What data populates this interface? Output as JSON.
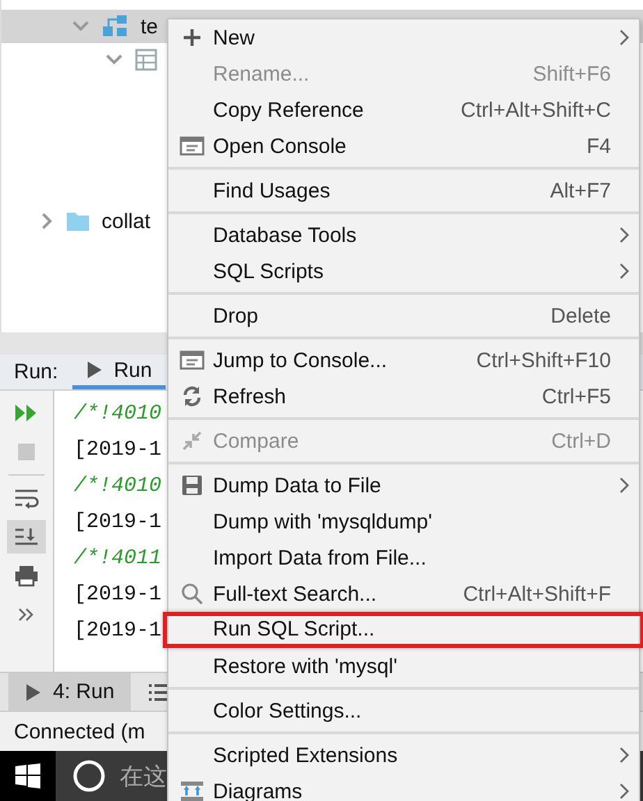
{
  "tree": {
    "items": [
      {
        "label": "te",
        "kind": "schema",
        "expanded": true,
        "selected": true
      },
      {
        "kind": "table",
        "expanded": true,
        "selected": false
      },
      {
        "label": "collat",
        "kind": "folder",
        "expanded": false,
        "selected": false
      }
    ]
  },
  "run_panel": {
    "title": "Run:",
    "tabs": [
      {
        "label": "Run",
        "selected": true
      }
    ],
    "toolbar": [
      {
        "kind": "rerun",
        "selected": false
      },
      {
        "kind": "stop",
        "selected": false
      },
      {
        "kind": "wrap",
        "selected": false
      },
      {
        "kind": "scroll",
        "selected": true
      },
      {
        "kind": "print",
        "selected": false
      },
      {
        "kind": "more",
        "selected": false
      }
    ],
    "lines": [
      {
        "kind": "comment",
        "text": "/*!4010"
      },
      {
        "kind": "log",
        "text": "[2019-1"
      },
      {
        "kind": "comment",
        "text": "/*!4010"
      },
      {
        "kind": "log",
        "text": "[2019-1"
      },
      {
        "kind": "comment",
        "text": "/*!4011"
      },
      {
        "kind": "log",
        "text": "[2019-1"
      },
      {
        "kind": "log",
        "text": "[2019-1"
      }
    ]
  },
  "tool_tabs": [
    {
      "label": "4: Run",
      "kind": "play",
      "selected": true
    },
    {
      "kind": "list",
      "selected": false
    }
  ],
  "status_bar": {
    "text": "Connected (m"
  },
  "taskbar": {
    "search_placeholder": "在这"
  },
  "menu": {
    "groups": [
      {
        "items": [
          {
            "label": "New",
            "kind": "plus",
            "submenu": true,
            "disabled": false,
            "selected": false
          },
          {
            "label": "Rename...",
            "shortcut": "Shift+F6",
            "submenu": false,
            "disabled": true,
            "selected": false
          },
          {
            "label": "Copy Reference",
            "shortcut": "Ctrl+Alt+Shift+C",
            "submenu": false,
            "disabled": false,
            "selected": false
          },
          {
            "label": "Open Console",
            "kind": "ql",
            "shortcut": "F4",
            "submenu": false,
            "disabled": false,
            "selected": false
          }
        ]
      },
      {
        "items": [
          {
            "label": "Find Usages",
            "shortcut": "Alt+F7",
            "submenu": false,
            "disabled": false,
            "selected": false
          }
        ]
      },
      {
        "items": [
          {
            "label": "Database Tools",
            "submenu": true,
            "disabled": false,
            "selected": false
          },
          {
            "label": "SQL Scripts",
            "submenu": true,
            "disabled": false,
            "selected": false
          }
        ]
      },
      {
        "items": [
          {
            "label": "Drop",
            "shortcut": "Delete",
            "submenu": false,
            "disabled": false,
            "selected": false
          }
        ]
      },
      {
        "items": [
          {
            "label": "Jump to Console...",
            "kind": "ql",
            "shortcut": "Ctrl+Shift+F10",
            "submenu": false,
            "disabled": false,
            "selected": false
          },
          {
            "label": "Refresh",
            "kind": "refresh",
            "shortcut": "Ctrl+F5",
            "submenu": false,
            "disabled": false,
            "selected": false
          }
        ]
      },
      {
        "items": [
          {
            "label": "Compare",
            "kind": "compare",
            "shortcut": "Ctrl+D",
            "submenu": false,
            "disabled": true,
            "selected": false
          }
        ]
      },
      {
        "items": [
          {
            "label": "Dump Data to File",
            "kind": "save",
            "submenu": true,
            "disabled": false,
            "selected": false
          },
          {
            "label": "Dump with 'mysqldump'",
            "submenu": false,
            "disabled": false,
            "selected": false
          },
          {
            "label": "Import Data from File...",
            "submenu": false,
            "disabled": false,
            "selected": false
          },
          {
            "label": "Full-text Search...",
            "kind": "search",
            "shortcut": "Ctrl+Alt+Shift+F",
            "submenu": false,
            "disabled": false,
            "selected": false
          },
          {
            "label": "Run SQL Script...",
            "submenu": false,
            "disabled": false,
            "selected": true
          },
          {
            "label": "Restore with 'mysql'",
            "submenu": false,
            "disabled": false,
            "selected": false
          }
        ]
      },
      {
        "items": [
          {
            "label": "Color Settings...",
            "submenu": false,
            "disabled": false,
            "selected": false
          }
        ]
      },
      {
        "items": [
          {
            "label": "Scripted Extensions",
            "submenu": true,
            "disabled": false,
            "selected": false
          },
          {
            "label": "Diagrams",
            "kind": "diagram",
            "submenu": true,
            "disabled": false,
            "selected": false
          }
        ]
      }
    ]
  }
}
